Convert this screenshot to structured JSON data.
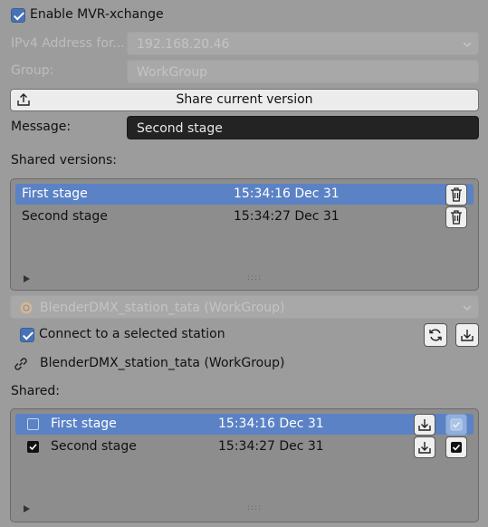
{
  "enable": {
    "label": "Enable MVR-xchange",
    "checked": true
  },
  "ipv4": {
    "label": "IPv4 Address for...",
    "value": "192.168.20.46"
  },
  "group": {
    "label": "Group:",
    "value": "WorkGroup"
  },
  "share_button": {
    "label": "Share current version"
  },
  "message": {
    "label": "Message:",
    "value": "Second stage"
  },
  "shared_versions": {
    "label": "Shared versions:",
    "rows": [
      {
        "name": "First stage",
        "time": "15:34:16 Dec 31",
        "selected": true
      },
      {
        "name": "Second stage",
        "time": "15:34:27 Dec 31",
        "selected": false
      }
    ]
  },
  "station_select": {
    "value": "BlenderDMX_station_tata (WorkGroup)"
  },
  "connect": {
    "label": "Connect to a selected station",
    "checked": true
  },
  "station_link": {
    "label": "BlenderDMX_station_tata (WorkGroup)"
  },
  "shared": {
    "label": "Shared:",
    "rows": [
      {
        "name": "First stage",
        "time": "15:34:16 Dec 31",
        "checked": false,
        "selected": true
      },
      {
        "name": "Second stage",
        "time": "15:34:27 Dec 31",
        "checked": true,
        "selected": false
      }
    ]
  },
  "colors": {
    "accent": "#4772b3",
    "selection": "#5b82c5",
    "background": "#9c9c9c"
  },
  "icons": [
    "upload-icon",
    "trash-icon",
    "refresh-icon",
    "download-icon",
    "link-icon",
    "chevron-down-icon",
    "expand-triangle-icon",
    "grip-handle-icon",
    "station-icon"
  ]
}
